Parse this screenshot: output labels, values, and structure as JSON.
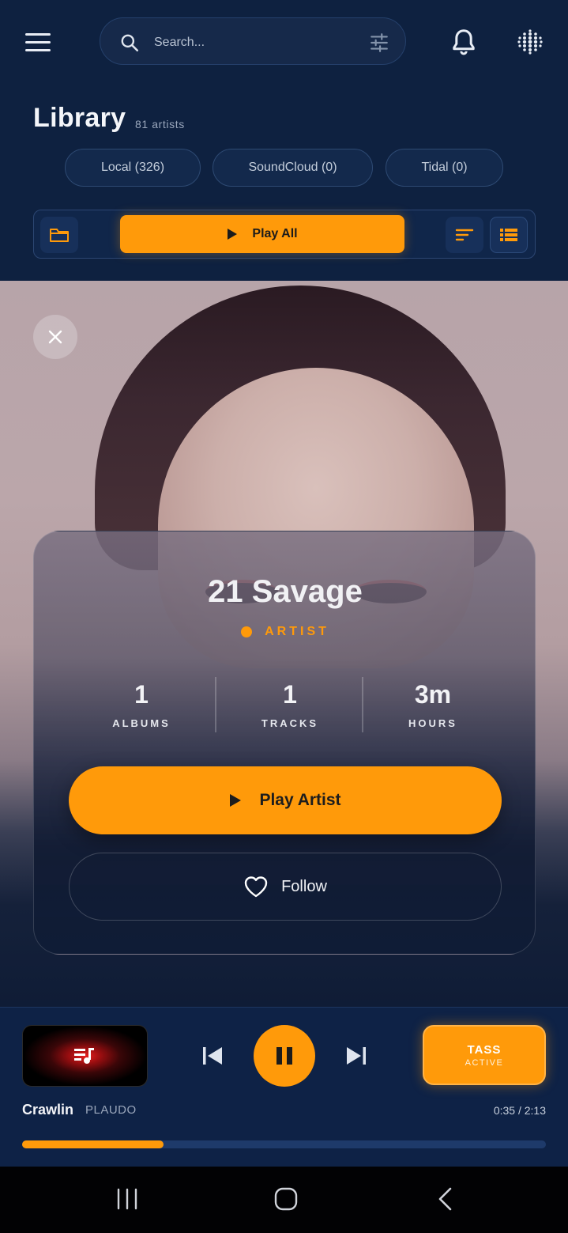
{
  "header": {
    "search_placeholder": "Search...",
    "menu_icon": "hamburger-menu-icon",
    "filter_icon": "sliders-icon",
    "bell_icon": "bell-icon",
    "grid_icon": "dots-grid-icon"
  },
  "library": {
    "title": "Library",
    "count": "81 artists",
    "sources": [
      {
        "label": "Local (326)"
      },
      {
        "label": "SoundCloud (0)"
      },
      {
        "label": "Tidal (0)"
      }
    ],
    "play_all": "Play All"
  },
  "artist": {
    "name": "21 Savage",
    "role": "ARTIST",
    "stats": [
      {
        "value": "1",
        "label": "ALBUMS"
      },
      {
        "value": "1",
        "label": "TRACKS"
      },
      {
        "value": "3m",
        "label": "HOURS"
      }
    ],
    "play_label": "Play Artist",
    "follow_label": "Follow"
  },
  "player": {
    "track": "Crawlin",
    "artist": "PLAUDO",
    "time": "0:35 / 2:13",
    "progress": 0.27,
    "tass_title": "TASS",
    "tass_status": "ACTIVE"
  },
  "colors": {
    "accent": "#ff9a0a",
    "background": "#0d1f3c"
  }
}
